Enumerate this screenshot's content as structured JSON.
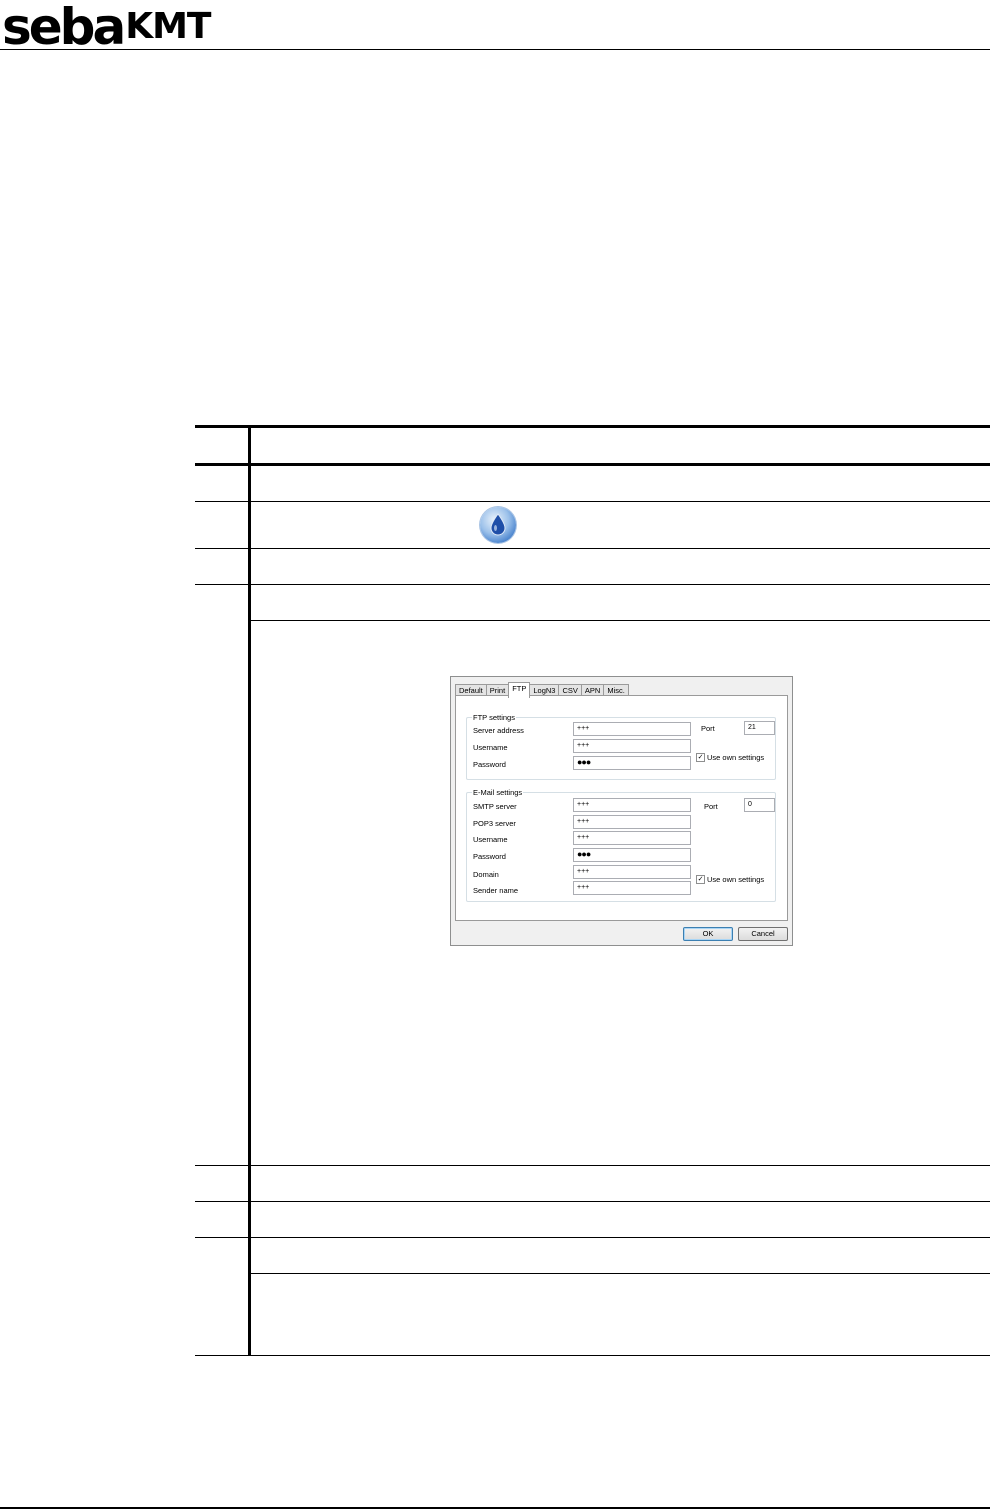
{
  "header": {
    "logo_part1": "seba",
    "logo_part2": "KMT"
  },
  "dialog": {
    "tabs": [
      "Default",
      "Print",
      "FTP",
      "LogN3",
      "CSV",
      "APN",
      "Misc."
    ],
    "active_tab": "FTP",
    "ftp": {
      "title": "FTP settings",
      "server_label": "Server address",
      "server_value": "+++",
      "username_label": "Username",
      "username_value": "+++",
      "password_label": "Password",
      "password_value": "●●●",
      "port_label": "Port",
      "port_value": "21",
      "own_settings_label": "Use own settings",
      "own_settings_checked": true
    },
    "email": {
      "title": "E-Mail settings",
      "smtp_label": "SMTP server",
      "smtp_value": "+++",
      "pop3_label": "POP3 server",
      "pop3_value": "+++",
      "username_label": "Username",
      "username_value": "+++",
      "password_label": "Password",
      "password_value": "●●●",
      "domain_label": "Domain",
      "domain_value": "+++",
      "sender_label": "Sender name",
      "sender_value": "+++",
      "port_label": "Port",
      "port_value": "0",
      "own_settings_label": "Use own settings",
      "own_settings_checked": true
    },
    "ok_label": "OK",
    "cancel_label": "Cancel",
    "check_mark": "✓"
  }
}
